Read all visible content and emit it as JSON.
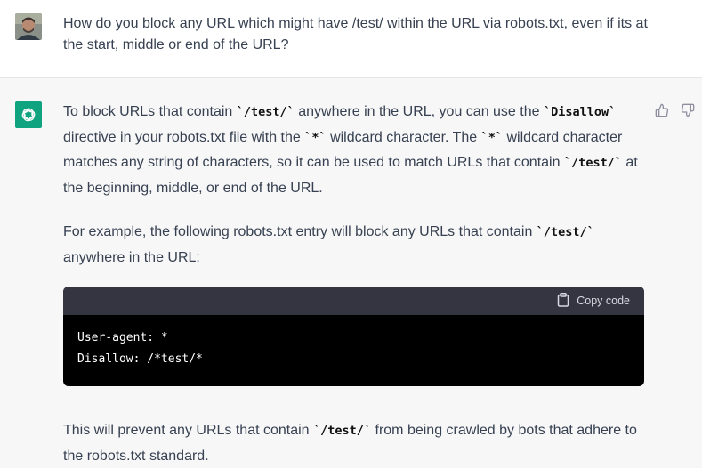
{
  "user": {
    "avatar_icon": "user-avatar",
    "question": "How do you block any URL which might have /test/ within the URL via robots.txt, even if its at the start, middle or end of the URL?"
  },
  "assistant": {
    "avatar_icon": "openai-logo-icon",
    "accent": "#10a37f",
    "p1": {
      "t1": "To block URLs that contain ",
      "c1": "`/test/`",
      "t2": " anywhere in the URL, you can use the ",
      "c2": "`Disallow`",
      "t3": " directive in your robots.txt file with the ",
      "c3": "`*`",
      "t4": " wildcard character. The ",
      "c4": "`*`",
      "t5": " wildcard character matches any string of characters, so it can be used to match URLs that contain ",
      "c5": "`/test/`",
      "t6": " at the beginning, middle, or end of the URL."
    },
    "p2": {
      "t1": "For example, the following robots.txt entry will block any URLs that contain ",
      "c1": "`/test/`",
      "t2": " anywhere in the URL:"
    },
    "code": {
      "copy_label": "Copy code",
      "copy_icon": "clipboard-icon",
      "content": "User-agent: *\nDisallow: /*test/*"
    },
    "p3": {
      "t1": "This will prevent any URLs that contain ",
      "c1": "`/test/`",
      "t2": " from being crawled by bots that adhere to the robots.txt standard."
    },
    "feedback": {
      "thumbs_up_icon": "thumbs-up-icon",
      "thumbs_down_icon": "thumbs-down-icon"
    }
  }
}
